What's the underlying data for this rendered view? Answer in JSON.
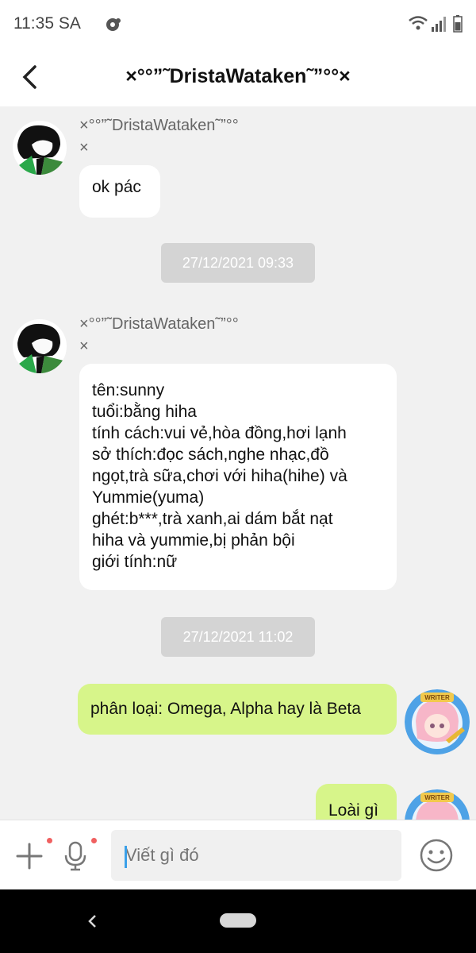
{
  "status_bar": {
    "time": "11:35 SA"
  },
  "header": {
    "title": "×°°”˜DristaWataken˜”°°×"
  },
  "messages": [
    {
      "sender_line1": "×°°”˜DristaWataken˜”°°",
      "sender_line2": "×",
      "lines": [
        "ok pác"
      ]
    },
    {
      "sender_line1": "×°°”˜DristaWataken˜”°°",
      "sender_line2": "×",
      "lines": [
        "tên:sunny",
        "tuổi:bằng hiha",
        "tính cách:vui vẻ,hòa đồng,hơi lạnh",
        "sở thích:đọc sách,nghe nhạc,đồ",
        "ngọt,trà sữa,chơi với hiha(hihe) và",
        "Yummie(yuma)",
        "ghét:b***,trà xanh,ai dám bắt nạt",
        "hiha và yummie,bị phản bội",
        "giới tính:nữ"
      ]
    },
    {
      "lines": [
        "phân loại: Omega, Alpha hay là Beta"
      ]
    },
    {
      "lines": [
        "Loài gì"
      ]
    }
  ],
  "timestamps": [
    "27/12/2021 09:33",
    "27/12/2021 11:02"
  ],
  "avatar_badge": "WRITER",
  "input": {
    "placeholder": "Viết gì đó"
  },
  "colors": {
    "my_bubble": "#d7f58a",
    "their_bubble": "#ffffff",
    "background": "#f1f1f1",
    "accent_dot": "#f06060"
  }
}
